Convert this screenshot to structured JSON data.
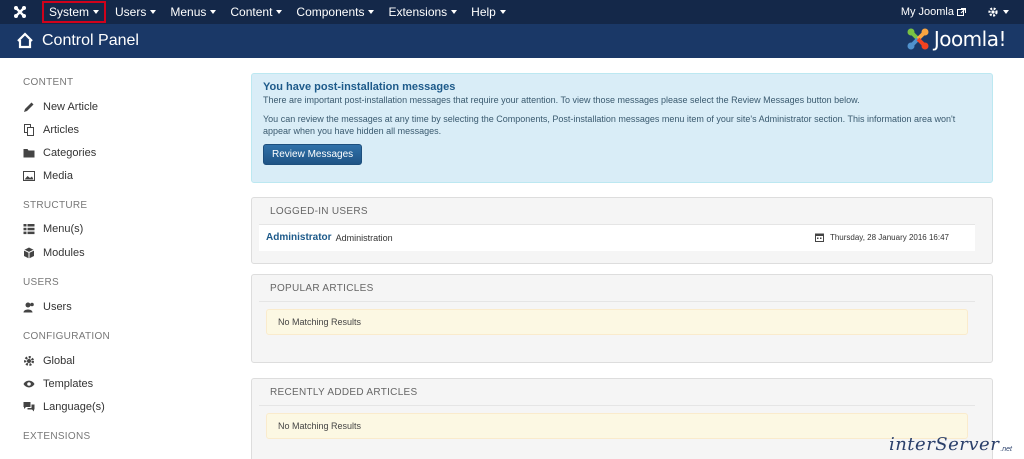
{
  "navbar": {
    "menu": [
      {
        "label": "System",
        "active": true
      },
      {
        "label": "Users"
      },
      {
        "label": "Menus"
      },
      {
        "label": "Content"
      },
      {
        "label": "Components"
      },
      {
        "label": "Extensions"
      },
      {
        "label": "Help"
      }
    ],
    "site_link": "My Joomla",
    "icons": [
      "joomla-logo-icon",
      "external-link-icon",
      "gear-icon"
    ]
  },
  "subhead": {
    "title": "Control Panel",
    "brand": "Joomla!"
  },
  "sidebar": {
    "sections": [
      {
        "heading": "CONTENT",
        "items": [
          "New Article",
          "Articles",
          "Categories",
          "Media"
        ]
      },
      {
        "heading": "STRUCTURE",
        "items": [
          "Menu(s)",
          "Modules"
        ]
      },
      {
        "heading": "USERS",
        "items": [
          "Users"
        ]
      },
      {
        "heading": "CONFIGURATION",
        "items": [
          "Global",
          "Templates",
          "Language(s)"
        ]
      },
      {
        "heading": "EXTENSIONS",
        "items": []
      }
    ]
  },
  "post_install": {
    "title": "You have post-installation messages",
    "line1": "There are important post-installation messages that require your attention. To view those messages please select the Review Messages button below.",
    "line2": "You can review the messages at any time by selecting the Components, Post-installation messages menu item of your site's Administrator section. This information area won't appear when you have hidden all messages.",
    "button": "Review Messages"
  },
  "logged_in": {
    "heading": "LOGGED-IN USERS",
    "rows": [
      {
        "user": "Administrator",
        "area": "Administration",
        "date": "Thursday, 28 January 2016 16:47"
      }
    ]
  },
  "popular": {
    "heading": "POPULAR ARTICLES",
    "empty": "No Matching Results"
  },
  "recent": {
    "heading": "RECENTLY ADDED ARTICLES",
    "empty": "No Matching Results"
  },
  "watermark": {
    "text": "interServer",
    "suffix": ".net"
  },
  "colors": {
    "navbar": "#142849",
    "subhead": "#1a3867",
    "alert_bg": "#d9edf7",
    "primary_button": "#2d6ca2",
    "active_outline": "#d0021b"
  }
}
